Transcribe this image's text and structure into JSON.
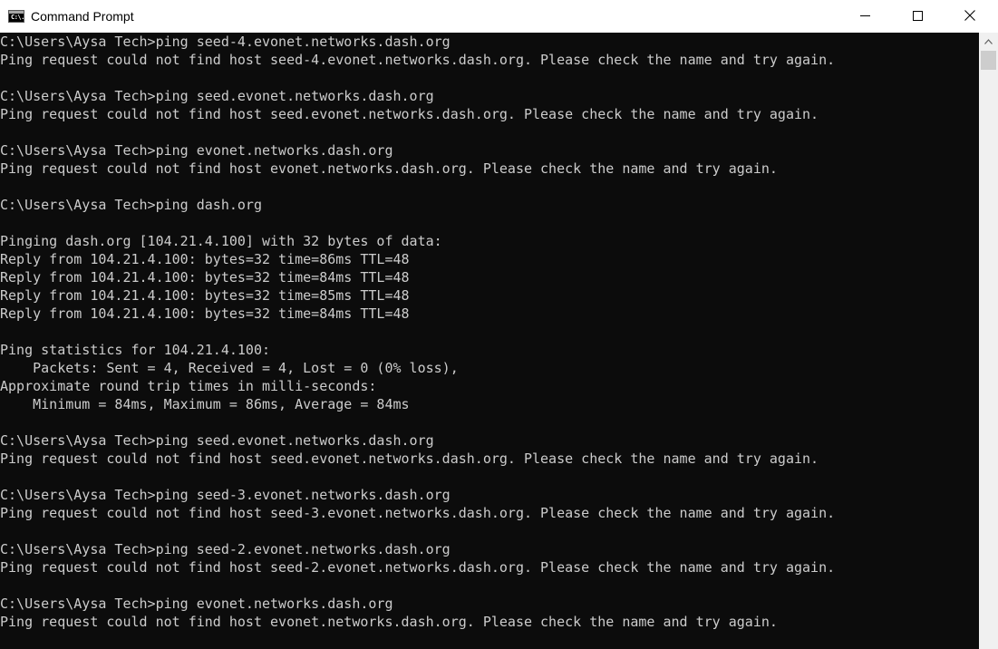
{
  "window": {
    "title": "Command Prompt",
    "icon": "cmd-app-icon",
    "icon_glyph": "C:\\.",
    "controls": [
      "minimize-icon",
      "maximize-icon",
      "close-icon"
    ]
  },
  "console": {
    "background": "#0c0c0c",
    "foreground": "#cccccc",
    "lines": [
      "C:\\Users\\Aysa Tech>ping seed-4.evonet.networks.dash.org",
      "Ping request could not find host seed-4.evonet.networks.dash.org. Please check the name and try again.",
      "",
      "C:\\Users\\Aysa Tech>ping seed.evonet.networks.dash.org",
      "Ping request could not find host seed.evonet.networks.dash.org. Please check the name and try again.",
      "",
      "C:\\Users\\Aysa Tech>ping evonet.networks.dash.org",
      "Ping request could not find host evonet.networks.dash.org. Please check the name and try again.",
      "",
      "C:\\Users\\Aysa Tech>ping dash.org",
      "",
      "Pinging dash.org [104.21.4.100] with 32 bytes of data:",
      "Reply from 104.21.4.100: bytes=32 time=86ms TTL=48",
      "Reply from 104.21.4.100: bytes=32 time=84ms TTL=48",
      "Reply from 104.21.4.100: bytes=32 time=85ms TTL=48",
      "Reply from 104.21.4.100: bytes=32 time=84ms TTL=48",
      "",
      "Ping statistics for 104.21.4.100:",
      "    Packets: Sent = 4, Received = 4, Lost = 0 (0% loss),",
      "Approximate round trip times in milli-seconds:",
      "    Minimum = 84ms, Maximum = 86ms, Average = 84ms",
      "",
      "C:\\Users\\Aysa Tech>ping seed.evonet.networks.dash.org",
      "Ping request could not find host seed.evonet.networks.dash.org. Please check the name and try again.",
      "",
      "C:\\Users\\Aysa Tech>ping seed-3.evonet.networks.dash.org",
      "Ping request could not find host seed-3.evonet.networks.dash.org. Please check the name and try again.",
      "",
      "C:\\Users\\Aysa Tech>ping seed-2.evonet.networks.dash.org",
      "Ping request could not find host seed-2.evonet.networks.dash.org. Please check the name and try again.",
      "",
      "C:\\Users\\Aysa Tech>ping evonet.networks.dash.org",
      "Ping request could not find host evonet.networks.dash.org. Please check the name and try again."
    ]
  },
  "scrollbar": {
    "up_arrow": "chevron-up-icon",
    "position": 0
  }
}
